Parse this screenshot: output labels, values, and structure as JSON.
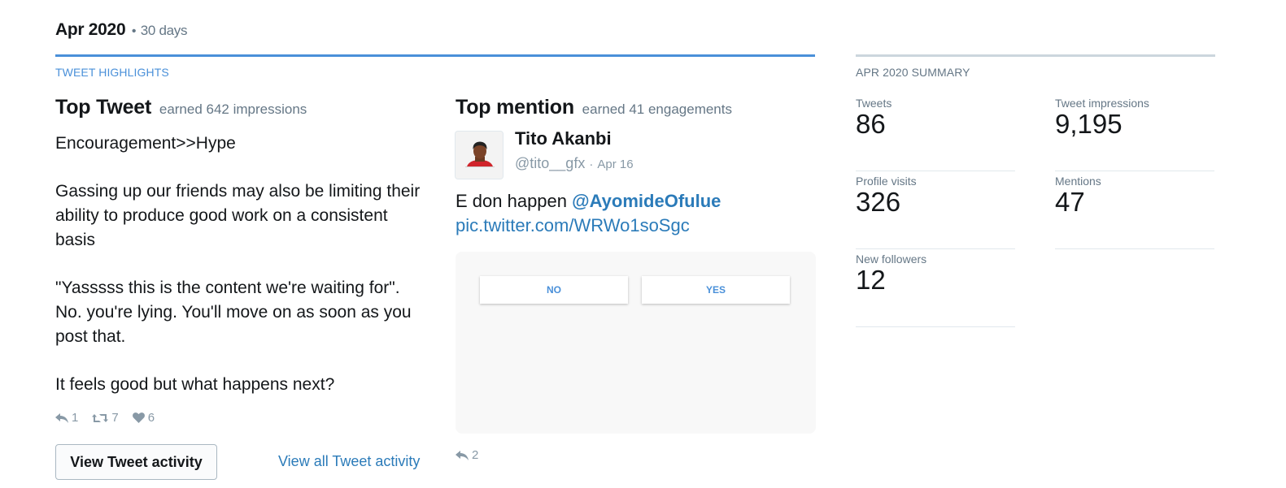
{
  "header": {
    "period": "Apr 2020",
    "separator": "•",
    "days": "30 days"
  },
  "highlights": {
    "section_label": "TWEET HIGHLIGHTS",
    "top_tweet": {
      "title": "Top Tweet",
      "earned": "earned 642 impressions",
      "paragraphs": [
        "Encouragement>>Hype",
        "Gassing up our friends may also be limiting their ability to produce good work on a consistent basis",
        "\"Yasssss this is the content we're waiting for\".  No. you're lying. You'll move on as soon as you post that.",
        "It feels good but what happens next?"
      ],
      "replies": "1",
      "retweets": "7",
      "likes": "6",
      "view_activity_label": "View Tweet activity",
      "view_all_label": "View all Tweet activity"
    },
    "top_mention": {
      "title": "Top mention",
      "earned": "earned 41 engagements",
      "author_name": "Tito Akanbi",
      "author_handle": "@tito__gfx",
      "meta_separator": "·",
      "date": "Apr 16",
      "text": "E don happen",
      "mention": "@AyomideOfulue",
      "pic_link": "pic.twitter.com/WRWo1soSgc",
      "poll_no": "NO",
      "poll_yes": "YES",
      "replies": "2"
    }
  },
  "summary": {
    "section_label": "APR 2020 SUMMARY",
    "stats": [
      {
        "label": "Tweets",
        "value": "86"
      },
      {
        "label": "Tweet impressions",
        "value": "9,195"
      },
      {
        "label": "Profile visits",
        "value": "326"
      },
      {
        "label": "Mentions",
        "value": "47"
      },
      {
        "label": "New followers",
        "value": "12"
      }
    ]
  },
  "colors": {
    "accent": "#4a90d9",
    "link": "#2b7bb9",
    "muted": "#657786",
    "text": "#14171a"
  }
}
